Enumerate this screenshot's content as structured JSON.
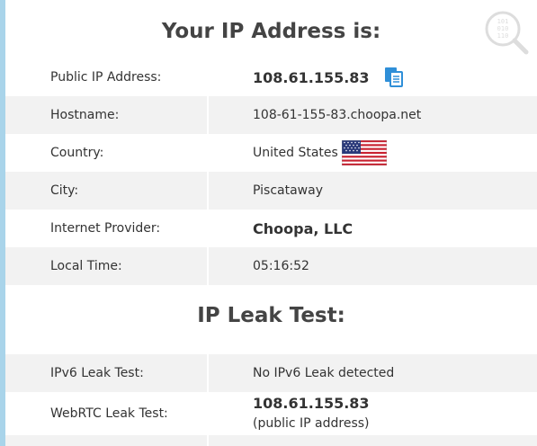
{
  "sections": {
    "ip_title": "Your IP Address is:",
    "leak_title": "IP Leak Test:"
  },
  "ip_rows": {
    "public_ip": {
      "label": "Public IP Address:",
      "value": "108.61.155.83"
    },
    "hostname": {
      "label": "Hostname:",
      "value": "108-61-155-83.choopa.net"
    },
    "country": {
      "label": "Country:",
      "value": "United States"
    },
    "city": {
      "label": "City:",
      "value": "Piscataway"
    },
    "provider": {
      "label": "Internet Provider:",
      "value": "Choopa, LLC"
    },
    "local_time": {
      "label": "Local Time:",
      "value": "05:16:52"
    }
  },
  "leak_rows": {
    "ipv6": {
      "label": "IPv6 Leak Test:",
      "value": "No IPv6 Leak detected"
    },
    "webrtc": {
      "label": "WebRTC Leak Test:",
      "value": "108.61.155.83",
      "note": "(public IP address)"
    }
  },
  "icons": {
    "copy": "copy-icon",
    "flag": "us-flag-icon",
    "watermark": "binary-magnifier-icon"
  },
  "colors": {
    "row_alt": "#f2f2f2",
    "left_border": "#a9d4ea",
    "copy_icon": "#2f8fd8"
  }
}
